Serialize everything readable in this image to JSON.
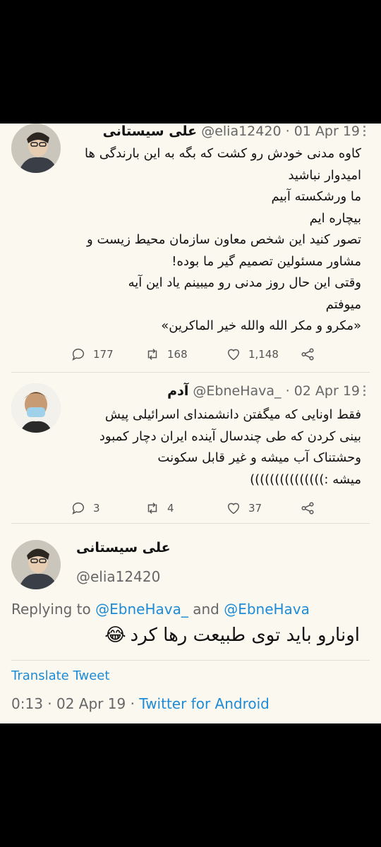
{
  "tweets": [
    {
      "name": "علی سیستانی",
      "handle": "@elia12420",
      "date": "01 Apr 19",
      "lines": [
        "کاوه مدنی خودش رو کشت که بگه به این بارندگی ها",
        "امیدوار نباشید",
        "ما ورشکسته آبیم",
        "بیچاره ایم",
        "تصور کنید این شخص معاون سازمان محیط زیست و",
        "مشاور مسئولین تصمیم گیر ما بوده!",
        "وقتی این حال روز مدنی رو میبینم یاد این آیه",
        "میوفتم",
        "«مکرو و مکر الله والله خیر الماکرین»"
      ],
      "replies": "177",
      "retweets": "168",
      "likes": "1,148"
    },
    {
      "name": "آدم",
      "handle": "@EbneHava_",
      "date": "02 Apr 19",
      "lines": [
        "فقط اونایی که میگفتن دانشمندای اسرائیلی پیش",
        "بینی کردن که طی چندسال آینده ایران دچار کمبود",
        "وحشتناک آب میشه و غیر قابل سکونت",
        "میشه :)))))))))))))))"
      ],
      "replies": "3",
      "retweets": "4",
      "likes": "37"
    }
  ],
  "focus": {
    "name": "علی سیستانی",
    "handle": "@elia12420",
    "replying_prefix": "Replying to",
    "reply_to_1": "@EbneHava_",
    "reply_and": "and",
    "reply_to_2": "@EbneHava",
    "text": "اونارو باید توی طبیعت رها کرد",
    "emoji": "😂",
    "translate": "Translate Tweet",
    "time": "0:13",
    "date": "02 Apr 19",
    "source": "Twitter for Android"
  },
  "colors": {
    "background": "#fbf8ef",
    "link": "#1d8bd6",
    "muted": "#666666"
  }
}
